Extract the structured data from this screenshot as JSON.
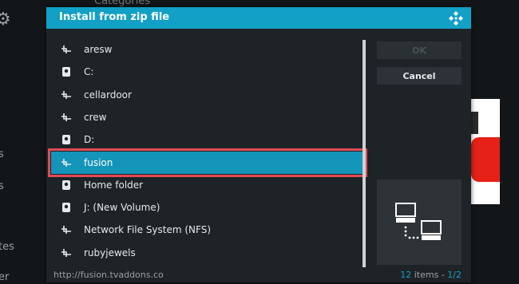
{
  "background": {
    "categories_label": "Categories",
    "side_fragments": [
      "s",
      "s",
      "tes",
      "er"
    ]
  },
  "dialog": {
    "title": "Install from zip file",
    "items": [
      {
        "label": "aresw",
        "icon": "network-share-icon"
      },
      {
        "label": "C:",
        "icon": "drive-icon"
      },
      {
        "label": "cellardoor",
        "icon": "network-share-icon"
      },
      {
        "label": "crew",
        "icon": "network-share-icon"
      },
      {
        "label": "D:",
        "icon": "drive-icon"
      },
      {
        "label": "fusion",
        "icon": "network-share-icon",
        "selected": true
      },
      {
        "label": "Home folder",
        "icon": "drive-icon"
      },
      {
        "label": "J: (New Volume)",
        "icon": "drive-icon"
      },
      {
        "label": "Network File System (NFS)",
        "icon": "network-share-icon"
      },
      {
        "label": "rubyjewels",
        "icon": "network-share-icon"
      }
    ],
    "ok_label": "OK",
    "cancel_label": "Cancel",
    "footer_path": "http://fusion.tvaddons.co",
    "count_items": "12",
    "count_suffix": " items - ",
    "count_page": "1/2"
  },
  "colors": {
    "header": "#12a0c7",
    "selection": "#1494b8",
    "selection_outline": "#e34a55",
    "accent": "#12a0c7"
  }
}
